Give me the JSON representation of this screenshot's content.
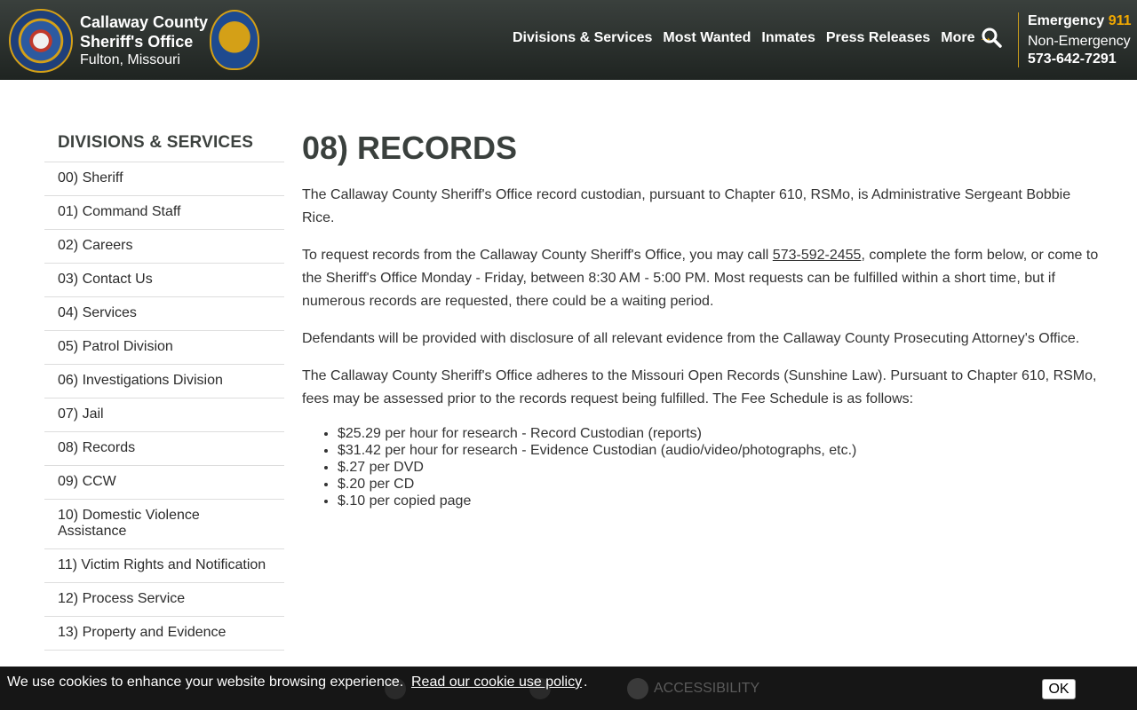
{
  "header": {
    "org_name_line1": "Callaway County",
    "org_name_line2": "Sheriff's Office",
    "location": "Fulton, Missouri",
    "nav": [
      {
        "label": "Divisions & Services"
      },
      {
        "label": "Most Wanted"
      },
      {
        "label": "Inmates"
      },
      {
        "label": "Press Releases"
      },
      {
        "label": "More"
      }
    ],
    "more_arrow": "→",
    "emergency_label": "Emergency",
    "emergency_number": "911",
    "non_emergency_label": "Non-Emergency",
    "non_emergency_number": "573-642-7291"
  },
  "sidebar": {
    "title": "DIVISIONS & SERVICES",
    "items": [
      {
        "label": "00) Sheriff"
      },
      {
        "label": "01) Command Staff"
      },
      {
        "label": "02) Careers"
      },
      {
        "label": "03) Contact Us"
      },
      {
        "label": "04) Services"
      },
      {
        "label": "05) Patrol Division"
      },
      {
        "label": "06) Investigations Division"
      },
      {
        "label": "07) Jail"
      },
      {
        "label": "08) Records"
      },
      {
        "label": "09) CCW"
      },
      {
        "label": "10) Domestic Violence Assistance"
      },
      {
        "label": "11) Victim Rights and Notification"
      },
      {
        "label": "12) Process Service"
      },
      {
        "label": "13) Property and Evidence"
      }
    ]
  },
  "main": {
    "title": "08) RECORDS",
    "p1": "The Callaway County Sheriff's Office record custodian, pursuant to Chapter 610, RSMo, is Administrative Sergeant Bobbie Rice.",
    "p2_before": "To request records from the Callaway County Sheriff's Office, you may call ",
    "p2_phone": "573-592-2455",
    "p2_after": ", complete the form below, or come to the Sheriff's Office Monday - Friday, between 8:30 AM - 5:00 PM.  Most requests can be fulfilled within a short time, but if numerous records are requested, there could be a waiting period.",
    "p3": "Defendants will be provided with disclosure of all relevant evidence from the Callaway County Prosecuting Attorney's Office.",
    "p4": "The Callaway County Sheriff's Office adheres to the Missouri Open Records (Sunshine Law).  Pursuant to Chapter 610, RSMo, fees may be assessed prior to the records request being fulfilled.  The Fee Schedule is as follows:",
    "fees": [
      "$25.29 per hour for research - Record Custodian (reports)",
      "$31.42 per hour for research - Evidence Custodian (audio/video/photographs, etc.)",
      "$.27 per DVD",
      "$.20 per CD",
      "$.10 per copied page"
    ]
  },
  "cookie": {
    "message": "We use cookies to enhance your website browsing experience.",
    "policy_link": "Read our cookie use policy",
    "after": ".",
    "ok_label": "OK",
    "accessibility_label": "ACCESSIBILITY"
  }
}
